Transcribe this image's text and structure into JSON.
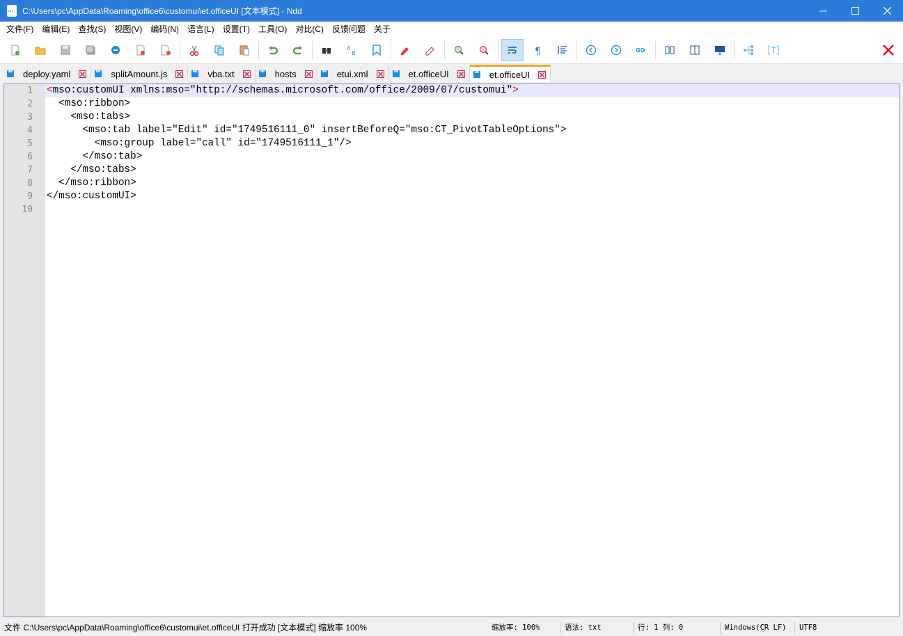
{
  "window": {
    "title": "C:\\Users\\pc\\AppData\\Roaming\\office6\\customui\\et.officeUI [文本模式] - Ndd",
    "app_icon": "txt-file-icon"
  },
  "menu": {
    "items": [
      "文件(F)",
      "编辑(E)",
      "查找(S)",
      "视图(V)",
      "编码(N)",
      "语言(L)",
      "设置(T)",
      "工具(O)",
      "对比(C)",
      "反馈问题",
      "关于"
    ]
  },
  "toolbar": {
    "buttons": [
      "new-file-icon",
      "open-folder-icon",
      "save-icon",
      "save-all-icon",
      "rename-icon",
      "close-file-icon",
      "close-all-icon",
      "cut-icon",
      "copy-icon",
      "paste-icon",
      "undo-icon",
      "redo-icon",
      "find-icon",
      "replace-icon",
      "bookmark-icon",
      "mark-icon",
      "clear-mark-icon",
      "zoom-in-icon",
      "zoom-out-icon",
      "word-wrap-icon",
      "show-symbols-icon",
      "indent-guide-icon",
      "prev-icon",
      "next-icon",
      "goto-icon",
      "compare-icon",
      "split-view-icon",
      "monitor-icon",
      "tree-icon",
      "text-mode-icon"
    ],
    "active": "word-wrap-icon",
    "close_color": "#e81123"
  },
  "tabs": [
    {
      "label": "deploy.yaml",
      "active": false
    },
    {
      "label": "splitAmount.js",
      "active": false
    },
    {
      "label": "vba.txt",
      "active": false
    },
    {
      "label": "hosts",
      "active": false
    },
    {
      "label": "etui.xml",
      "active": false
    },
    {
      "label": "et.officeUI",
      "active": false
    },
    {
      "label": "et.officeUI",
      "active": true
    }
  ],
  "editor": {
    "line_numbers": [
      "1",
      "2",
      "3",
      "4",
      "5",
      "6",
      "7",
      "8",
      "9",
      "10"
    ],
    "lines": [
      {
        "pre": "<",
        "text": "mso:customUI xmlns:mso=\"http://schemas.microsoft.com/office/2009/07/customui\"",
        "post": ">"
      },
      {
        "pre": "",
        "text": "  <mso:ribbon>",
        "post": ""
      },
      {
        "pre": "",
        "text": "    <mso:tabs>",
        "post": ""
      },
      {
        "pre": "",
        "text": "      <mso:tab label=\"Edit\" id=\"1749516111_0\" insertBeforeQ=\"mso:CT_PivotTableOptions\">",
        "post": ""
      },
      {
        "pre": "",
        "text": "        <mso:group label=\"call\" id=\"1749516111_1\"/>",
        "post": ""
      },
      {
        "pre": "",
        "text": "      </mso:tab>",
        "post": ""
      },
      {
        "pre": "",
        "text": "    </mso:tabs>",
        "post": ""
      },
      {
        "pre": "",
        "text": "  </mso:ribbon>",
        "post": ""
      },
      {
        "pre": "",
        "text": "</mso:customUI>",
        "post": ""
      },
      {
        "pre": "",
        "text": "",
        "post": ""
      }
    ],
    "current_line": 0
  },
  "status": {
    "file": "文件 C:\\Users\\pc\\AppData\\Roaming\\office6\\customui\\et.officeUI 打开成功 [文本模式] 缩放率 100%",
    "zoom": "缩放率: 100%",
    "syntax": "语法: txt",
    "position": "行: 1 列: 0",
    "eol": "Windows(CR LF)",
    "encoding": "UTF8"
  }
}
